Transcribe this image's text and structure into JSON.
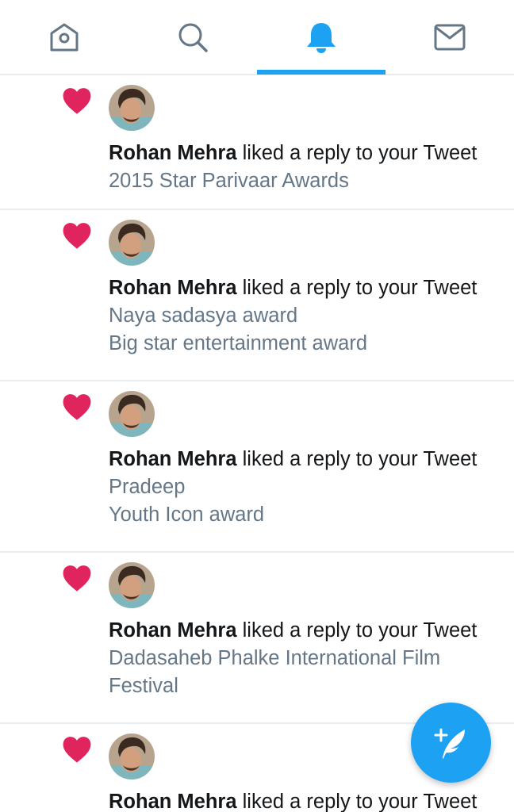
{
  "nav": {
    "tabs": [
      {
        "name": "home",
        "icon": "home-icon",
        "active": false
      },
      {
        "name": "search",
        "icon": "search-icon",
        "active": false
      },
      {
        "name": "notifications",
        "icon": "bell-icon",
        "active": true
      },
      {
        "name": "messages",
        "icon": "mail-icon",
        "active": false
      }
    ],
    "accent_color": "#1da1f2",
    "inactive_color": "#657786"
  },
  "notifications": [
    {
      "icon": "heart-icon",
      "user": "Rohan Mehra",
      "action": "liked a reply to your Tweet",
      "lines": [
        "2015 Star Parivaar Awards"
      ]
    },
    {
      "icon": "heart-icon",
      "user": "Rohan Mehra",
      "action": "liked a reply to your Tweet",
      "lines": [
        "Naya sadasya award",
        "Big star entertainment award"
      ]
    },
    {
      "icon": "heart-icon",
      "user": "Rohan Mehra",
      "action": "liked a reply to your Tweet",
      "lines": [
        "Pradeep",
        "Youth Icon award"
      ]
    },
    {
      "icon": "heart-icon",
      "user": "Rohan Mehra",
      "action": "liked a reply to your Tweet",
      "lines": [
        "Dadasaheb Phalke International Film",
        "Festival"
      ]
    },
    {
      "icon": "heart-icon",
      "user": "Rohan Mehra",
      "action": "liked a reply to your Tweet",
      "lines": []
    }
  ],
  "colors": {
    "heart": "#e0245e",
    "secondary_text": "#657786",
    "divider": "#e6ecf0"
  },
  "fab": {
    "icon": "compose-tweet-icon"
  }
}
